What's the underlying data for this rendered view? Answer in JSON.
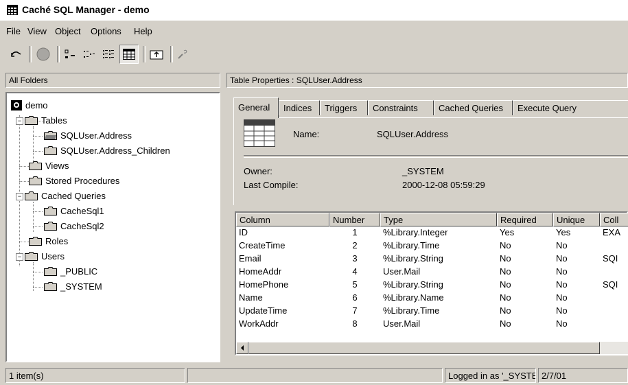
{
  "window": {
    "title": "Caché SQL Manager - demo",
    "app_icon": "table-grid-icon"
  },
  "menu": [
    {
      "label": "File",
      "accel": "F"
    },
    {
      "label": "View",
      "accel": "V"
    },
    {
      "label": "Object",
      "accel": "O"
    },
    {
      "label": "Options",
      "accel": "p"
    },
    {
      "label": "Help",
      "accel": "H"
    }
  ],
  "toolbar": {
    "buttons": [
      "undo-icon",
      "stop-icon",
      "large-icons-view-icon",
      "small-icons-view-icon",
      "list-view-icon",
      "details-view-icon",
      "up-folder-icon",
      "wizard-icon"
    ]
  },
  "left_pane": {
    "header": "All Folders",
    "tree": [
      {
        "label": "demo",
        "icon": "database-icon"
      },
      {
        "label": "Tables",
        "icon": "folder-icon"
      },
      {
        "label": "SQLUser.Address",
        "icon": "open-folder-icon"
      },
      {
        "label": "SQLUser.Address_Children",
        "icon": "folder-icon"
      },
      {
        "label": "Views",
        "icon": "folder-icon"
      },
      {
        "label": "Stored Procedures",
        "icon": "folder-icon"
      },
      {
        "label": "Cached Queries",
        "icon": "folder-icon"
      },
      {
        "label": "CacheSql1",
        "icon": "folder-icon"
      },
      {
        "label": "CacheSql2",
        "icon": "folder-icon"
      },
      {
        "label": "Roles",
        "icon": "folder-icon"
      },
      {
        "label": "Users",
        "icon": "folder-icon"
      },
      {
        "label": "_PUBLIC",
        "icon": "folder-icon"
      },
      {
        "label": "_SYSTEM",
        "icon": "folder-icon"
      }
    ]
  },
  "right_pane": {
    "header": "Table Properties : SQLUser.Address",
    "tabs": [
      "General",
      "Indices",
      "Triggers",
      "Constraints",
      "Cached Queries",
      "Execute Query"
    ],
    "active_tab": "General",
    "general": {
      "name_label": "Name:",
      "name_value": "SQLUser.Address",
      "owner_label": "Owner:",
      "owner_value": "_SYSTEM",
      "compile_label": "Last Compile:",
      "compile_value": "2000-12-08 05:59:29"
    },
    "columns_grid": {
      "headers": [
        "Column",
        "Number",
        "Type",
        "Required",
        "Unique",
        "Coll"
      ],
      "rows": [
        [
          "ID",
          "1",
          "%Library.Integer",
          "Yes",
          "Yes",
          "EXA"
        ],
        [
          "CreateTime",
          "2",
          "%Library.Time",
          "No",
          "No",
          ""
        ],
        [
          "Email",
          "3",
          "%Library.String",
          "No",
          "No",
          "SQI"
        ],
        [
          "HomeAddr",
          "4",
          "User.Mail",
          "No",
          "No",
          ""
        ],
        [
          "HomePhone",
          "5",
          "%Library.String",
          "No",
          "No",
          "SQI"
        ],
        [
          "Name",
          "6",
          "%Library.Name",
          "No",
          "No",
          ""
        ],
        [
          "UpdateTime",
          "7",
          "%Library.Time",
          "No",
          "No",
          ""
        ],
        [
          "WorkAddr",
          "8",
          "User.Mail",
          "No",
          "No",
          ""
        ]
      ]
    }
  },
  "status_bar": {
    "items": "1 item(s)",
    "empty": "",
    "user": "Logged in as '_SYSTEM'",
    "date": "2/7/01"
  }
}
